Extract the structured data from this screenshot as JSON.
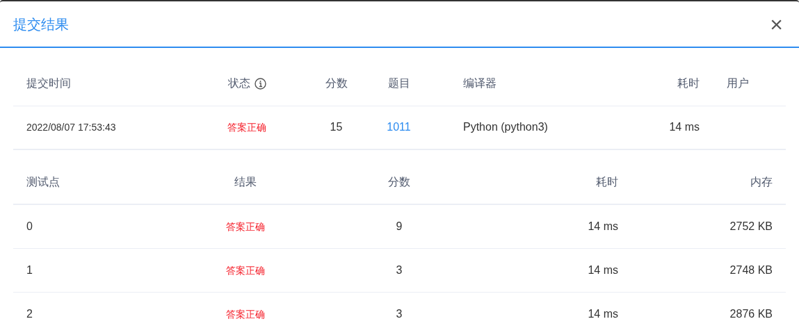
{
  "dialog": {
    "title": "提交结果",
    "close": "×"
  },
  "summary": {
    "columns": [
      "提交时间",
      "状态",
      "分数",
      "题目",
      "编译器",
      "耗时",
      "用户"
    ],
    "row": {
      "time": "2022/08/07 17:53:43",
      "status": "答案正确",
      "score": "15",
      "problem": "1011",
      "compiler": "Python (python3)",
      "elapsed": "14 ms"
    }
  },
  "cases": {
    "columns": [
      "测试点",
      "结果",
      "分数",
      "耗时",
      "内存"
    ],
    "rows": [
      {
        "id": "0",
        "result": "答案正确",
        "score": "9",
        "elapsed": "14 ms",
        "memory": "2752 KB"
      },
      {
        "id": "1",
        "result": "答案正确",
        "score": "3",
        "elapsed": "14 ms",
        "memory": "2748 KB"
      },
      {
        "id": "2",
        "result": "答案正确",
        "score": "3",
        "elapsed": "14 ms",
        "memory": "2876 KB"
      }
    ]
  }
}
